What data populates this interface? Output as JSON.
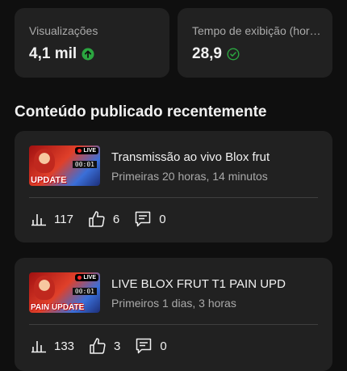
{
  "stats": [
    {
      "label": "Visualizações",
      "value": "4,1 mil",
      "indicator_icon": "arrow-up-circle-icon",
      "indicator_color": "#2ba640"
    },
    {
      "label": "Tempo de exibição (hor…",
      "value": "28,9",
      "indicator_icon": "check-circle-icon",
      "indicator_color": "#2ba640"
    }
  ],
  "section_title": "Conteúdo publicado recentemente",
  "videos": [
    {
      "title": "Transmissão ao vivo Blox frut",
      "subtitle": "Primeiras 20 horas, 14 minutos",
      "thumb": {
        "badge": "LIVE",
        "time": "00:01",
        "text": "UPDATE"
      },
      "views": "117",
      "likes": "6",
      "comments": "0"
    },
    {
      "title": "LIVE BLOX FRUT T1 PAIN UPD",
      "subtitle": "Primeiros 1 dias, 3 horas",
      "thumb": {
        "badge": "LIVE",
        "time": "00:01",
        "text": "PAIN UPDATE"
      },
      "views": "133",
      "likes": "3",
      "comments": "0"
    }
  ]
}
